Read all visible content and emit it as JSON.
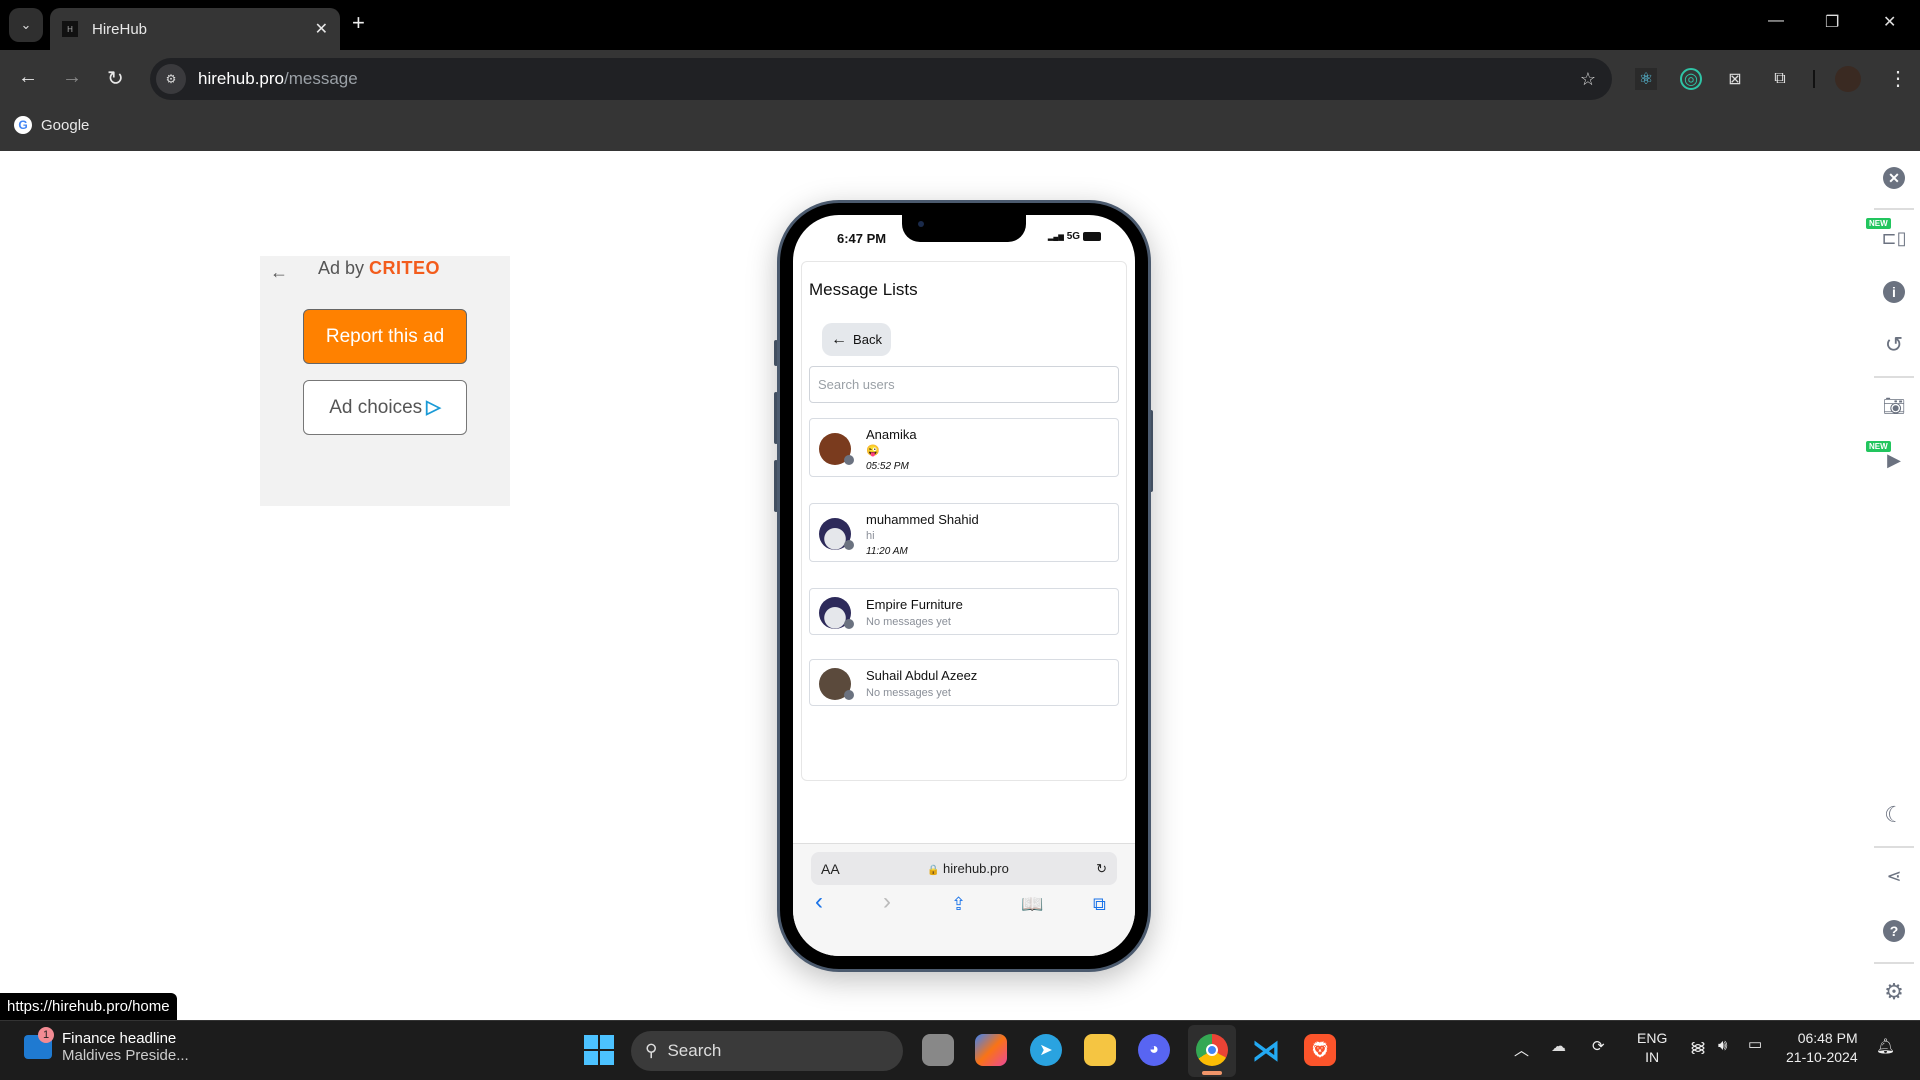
{
  "browser": {
    "tab_title": "HireHub",
    "tab_favicon": "H",
    "url_host": "hirehub.pro",
    "url_path": "/message",
    "bookmark": "Google",
    "hover_url": "https://hirehub.pro/home",
    "extensions": [
      "react-devtools-icon",
      "extension-target-icon",
      "extension-close-icon",
      "puzzle-icon"
    ],
    "icons": {
      "back": "←",
      "forward": "→",
      "reload": "↻",
      "star": "☆",
      "menu": "⋮",
      "new_tab": "+",
      "close": "✕",
      "minimize": "—",
      "restore": "❐",
      "window_close": "✕",
      "tab_list": "⌄"
    }
  },
  "ad": {
    "back": "←",
    "ad_by": "Ad by",
    "brand": "CRITEO",
    "report_label": "Report this ad",
    "choices_label": "Ad choices",
    "choices_icon": "▷"
  },
  "phone": {
    "status_time": "6:47 PM",
    "network": "5G",
    "signal": "▂▄▆",
    "page_title": "Message Lists",
    "back_label": "Back",
    "back_icon": "←",
    "search_placeholder": "Search users",
    "conversations": [
      {
        "name": "Anamika",
        "message": "😜",
        "time": "05:52 PM",
        "avatar_color": "#7a3b1e"
      },
      {
        "name": "muhammed Shahid",
        "message": "hi",
        "time": "11:20 AM",
        "avatar_color": "#2d2a5a"
      },
      {
        "name": "Empire Furniture",
        "message": "No messages yet",
        "time": "",
        "avatar_color": "#2d2a5a"
      },
      {
        "name": "Suhail Abdul Azeez",
        "message": "No messages yet",
        "time": "",
        "avatar_color": "#5b4a3c"
      }
    ],
    "safari": {
      "text_size": "AA",
      "url": "hirehub.pro",
      "lock": "🔒",
      "reload": "↻",
      "back": "‹",
      "forward": "›",
      "share": "⇪",
      "bookmarks": "📖",
      "tabs": "⧉"
    }
  },
  "right_sidebar": {
    "new_badge": "NEW",
    "items": [
      "close-icon",
      "device-icon",
      "info-icon",
      "rotate-icon",
      "camera-icon",
      "video-icon",
      "dark-mode-icon",
      "share-icon",
      "help-icon",
      "settings-icon"
    ]
  },
  "taskbar": {
    "widget_title": "Finance headline",
    "widget_subtitle": "Maldives Preside...",
    "widget_badge": "1",
    "search_label": "Search",
    "apps": [
      "task-view",
      "copilot",
      "telegram",
      "file-explorer",
      "discord",
      "chrome",
      "vscode",
      "brave"
    ],
    "lang_1": "ENG",
    "lang_2": "IN",
    "time": "06:48 PM",
    "date": "21-10-2024"
  }
}
